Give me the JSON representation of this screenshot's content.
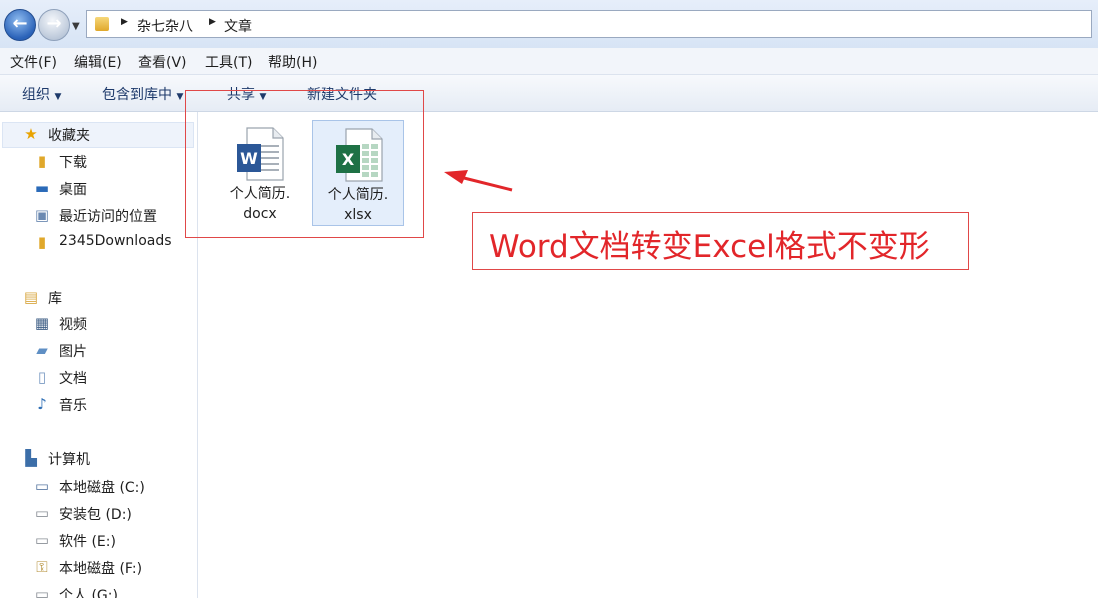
{
  "breadcrumb": {
    "items": [
      "杂七杂八",
      "文章"
    ]
  },
  "menu": [
    "文件(F)",
    "编辑(E)",
    "查看(V)",
    "工具(T)",
    "帮助(H)"
  ],
  "toolbar": [
    "组织",
    "包含到库中",
    "共享",
    "新建文件夹"
  ],
  "sidebar": {
    "favorites": {
      "label": "收藏夹",
      "items": [
        "下载",
        "桌面",
        "最近访问的位置",
        "2345Downloads"
      ]
    },
    "libraries": {
      "label": "库",
      "items": [
        "视频",
        "图片",
        "文档",
        "音乐"
      ]
    },
    "computer": {
      "label": "计算机",
      "items": [
        "本地磁盘 (C:)",
        "安装包 (D:)",
        "软件 (E:)",
        "本地磁盘 (F:)",
        "个人 (G:)"
      ]
    }
  },
  "files": [
    {
      "name_line1": "个人简历.",
      "name_line2": "docx",
      "icon": "word-doc-icon",
      "color": "#2b5797",
      "letter": "W"
    },
    {
      "name_line1": "个人简历.",
      "name_line2": "xlsx",
      "icon": "excel-doc-icon",
      "color": "#1e7145",
      "letter": "X"
    }
  ],
  "annotation": {
    "text": "Word文档转变Excel格式不变形",
    "color": "#e2262a"
  }
}
